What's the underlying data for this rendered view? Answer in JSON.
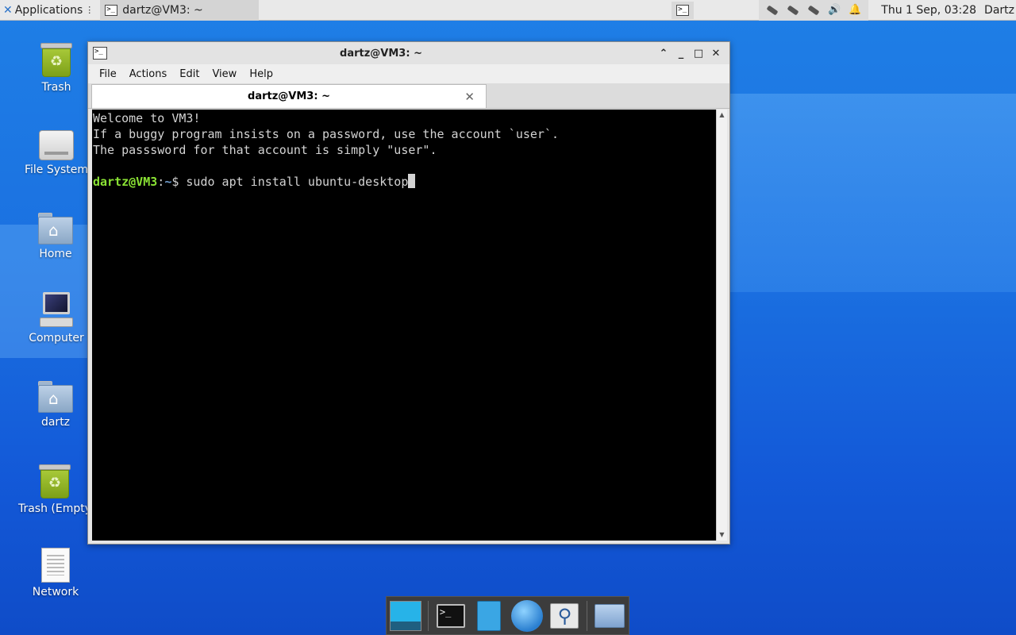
{
  "top_panel": {
    "applications_label": "Applications",
    "task_title": "dartz@VM3: ~",
    "clock": "Thu  1 Sep, 03:28",
    "user": "Dartz",
    "tray_icons": [
      "network-icon",
      "network-icon",
      "network-icon",
      "volume-icon",
      "notification-bell-icon"
    ]
  },
  "desktop_icons": [
    {
      "label": "Trash",
      "icon": "trash-icon"
    },
    {
      "label": "File System",
      "icon": "drive-icon"
    },
    {
      "label": "Home",
      "icon": "home-folder-icon"
    },
    {
      "label": "Computer",
      "icon": "computer-icon"
    },
    {
      "label": "dartz",
      "icon": "home-folder-icon"
    },
    {
      "label": "Trash (Empty",
      "icon": "trash-icon"
    },
    {
      "label": "Network",
      "icon": "document-icon"
    }
  ],
  "window": {
    "title": "dartz@VM3: ~",
    "menu": [
      "File",
      "Actions",
      "Edit",
      "View",
      "Help"
    ],
    "tab_title": "dartz@VM3: ~",
    "terminal": {
      "lines": [
        "Welcome to VM3!",
        "If a buggy program insists on a password, use the account `user`.",
        "The passsword for that account is simply \"user\"."
      ],
      "prompt_user": "dartz@VM3",
      "prompt_sep": ":",
      "prompt_path": "~",
      "prompt_symbol": "$ ",
      "command": "sudo apt install ubuntu-desktop"
    }
  },
  "colors": {
    "prompt_user": "#8ae234",
    "prompt_path": "#729fcf",
    "terminal_bg": "#000000",
    "terminal_fg": "#d3d3d3"
  },
  "dock": {
    "items": [
      "desktop-icon",
      "terminal-icon",
      "file-manager-icon",
      "web-browser-icon",
      "app-finder-icon",
      "folder-icon"
    ]
  }
}
